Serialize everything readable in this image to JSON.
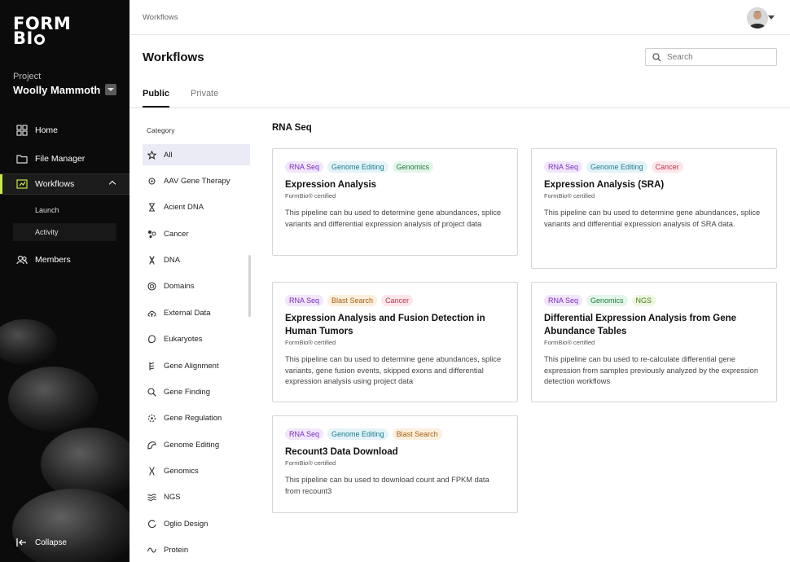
{
  "brand": {
    "logo_line1": "FORM",
    "logo_line2_a": "BI",
    "accent": "#c6e84a"
  },
  "sidebar": {
    "project_label": "Project",
    "project_name": "Woolly Mammoth",
    "nav": [
      {
        "label": "Home",
        "icon": "grid-icon"
      },
      {
        "label": "File Manager",
        "icon": "folder-icon"
      },
      {
        "label": "Workflows",
        "icon": "workflow-icon"
      },
      {
        "label": "Members",
        "icon": "members-icon"
      }
    ],
    "sub_items": [
      "Launch",
      "Activity"
    ],
    "collapse_label": "Collapse"
  },
  "header": {
    "breadcrumb": "Workflows",
    "title": "Workflows",
    "search_placeholder": "Search"
  },
  "tabs": [
    "Public",
    "Private"
  ],
  "categories": {
    "title": "Category",
    "items": [
      "All",
      "AAV Gene Therapy",
      "Acient DNA",
      "Cancer",
      "DNA",
      "Domains",
      "External Data",
      "Eukaryotes",
      "Gene Alignment",
      "Gene Finding",
      "Gene Regulation",
      "Genome Editing",
      "Genomics",
      "NGS",
      "Oglio Design",
      "Protein"
    ]
  },
  "section_title": "RNA Seq",
  "cards": [
    {
      "tags": [
        "RNA Seq",
        "Genome Editing",
        "Genomics"
      ],
      "title": "Expression Analysis",
      "certified": "FormBio® certified",
      "description": "This pipeline can bu used to determine gene abundances, splice variants and differential expression analysis of project data"
    },
    {
      "tags": [
        "RNA Seq",
        "Genome Editing",
        "Cancer"
      ],
      "title": "Expression Analysis (SRA)",
      "certified": "FormBio® certified",
      "description": "This pipeline can bu used to determine gene abundances, splice variants and differential expression analysis of SRA data."
    },
    {
      "tags": [
        "RNA Seq",
        "Blast Search",
        "Cancer"
      ],
      "title": "Expression Analysis and Fusion Detection in Human Tumors",
      "certified": "FormBio® certified",
      "description": "This pipeline can bu used to determine gene abundances, splice variants, gene fusion events, skipped exons and differential expression analysis using project data"
    },
    {
      "tags": [
        "RNA Seq",
        "Genomics",
        "NGS"
      ],
      "title": "Differential Expression Analysis from Gene Abundance Tables",
      "certified": "FormBio® certified",
      "description": "This pipeline can bu used to re-calculate differential gene expression from samples previously analyzed by the expression detection workflows"
    },
    {
      "tags": [
        "RNA Seq",
        "Genome Editing",
        "Blast Search"
      ],
      "title": "Recount3 Data Download",
      "certified": "FormBio® certified",
      "description": "This pipeline can bu used to download count and FPKM data from recount3"
    }
  ]
}
